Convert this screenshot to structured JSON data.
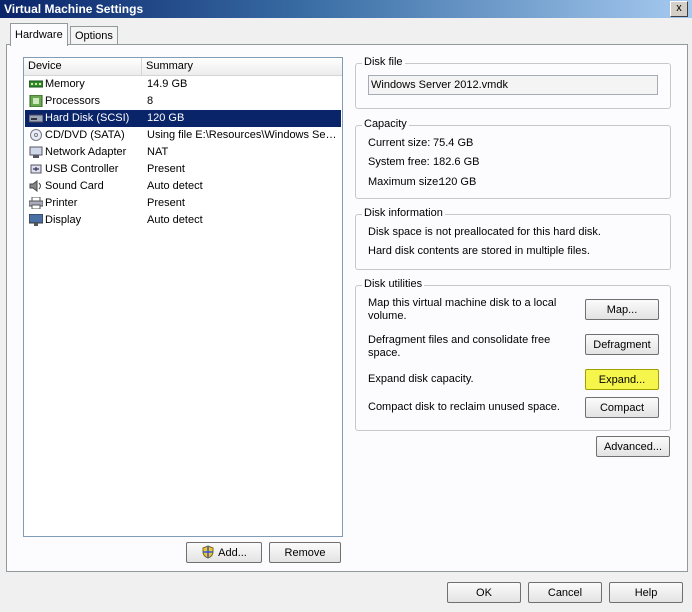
{
  "window": {
    "title": "Virtual Machine Settings",
    "close_glyph": "x"
  },
  "tabs": [
    {
      "label": "Hardware",
      "active": true
    },
    {
      "label": "Options",
      "active": false
    }
  ],
  "device_list": {
    "headers": {
      "device": "Device",
      "summary": "Summary"
    },
    "rows": [
      {
        "device": "Memory",
        "summary": "14.9 GB",
        "icon": "memory-icon"
      },
      {
        "device": "Processors",
        "summary": "8",
        "icon": "processor-icon"
      },
      {
        "device": "Hard Disk (SCSI)",
        "summary": "120 GB",
        "icon": "hard-disk-icon",
        "selected": true
      },
      {
        "device": "CD/DVD (SATA)",
        "summary": "Using file E:\\Resources\\Windows Server 2012...",
        "icon": "cd-dvd-icon"
      },
      {
        "device": "Network Adapter",
        "summary": "NAT",
        "icon": "network-adapter-icon"
      },
      {
        "device": "USB Controller",
        "summary": "Present",
        "icon": "usb-icon"
      },
      {
        "device": "Sound Card",
        "summary": "Auto detect",
        "icon": "sound-card-icon"
      },
      {
        "device": "Printer",
        "summary": "Present",
        "icon": "printer-icon"
      },
      {
        "device": "Display",
        "summary": "Auto detect",
        "icon": "display-icon"
      }
    ]
  },
  "list_buttons": {
    "add": "Add...",
    "remove": "Remove"
  },
  "disk_file": {
    "label": "Disk file",
    "value": "Windows Server 2012.vmdk"
  },
  "capacity": {
    "label": "Capacity",
    "current_label": "Current size:",
    "current_value": "75.4 GB",
    "free_label": "System free:",
    "free_value": "182.6 GB",
    "max_label": "Maximum size:",
    "max_value": "120 GB"
  },
  "disk_info": {
    "label": "Disk information",
    "line1": "Disk space is not preallocated for this hard disk.",
    "line2": "Hard disk contents are stored in multiple files."
  },
  "disk_utilities": {
    "label": "Disk utilities",
    "map_desc_1": "Map this virtual machine disk to a local",
    "map_desc_2": "volume.",
    "map_button": "Map...",
    "defrag_desc_1": "Defragment files and consolidate free",
    "defrag_desc_2": "space.",
    "defrag_button": "Defragment",
    "expand_desc": "Expand disk capacity.",
    "expand_button": "Expand...",
    "compact_desc": "Compact disk to reclaim unused space.",
    "compact_button": "Compact"
  },
  "advanced_button": "Advanced...",
  "footer": {
    "ok": "OK",
    "cancel": "Cancel",
    "help": "Help"
  },
  "colors": {
    "selection": "#0a246a",
    "highlight": "#f6f54b"
  }
}
